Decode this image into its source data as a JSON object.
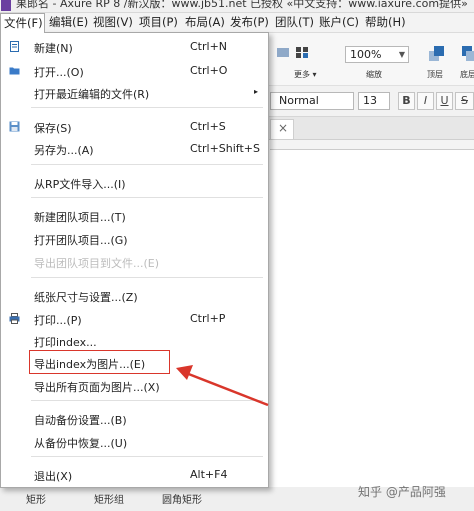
{
  "window": {
    "title": "果郎名 - Axure RP 8 /新汉版：www.jb51.net  已授权      «中文支持：www.iaxure.com提供»"
  },
  "menubar": {
    "items": [
      "文件(F)",
      "编辑(E)",
      "视图(V)",
      "项目(P)",
      "布局(A)",
      "发布(P)",
      "团队(T)",
      "账户(C)",
      "帮助(H)"
    ]
  },
  "toolbar": {
    "zoom_value": "100%",
    "zoom_label": "缩放",
    "more_label": "更多 ▾",
    "top_label": "顶层",
    "bottom_label": "底层"
  },
  "formatbar": {
    "font_value": "Normal",
    "size_value": "13",
    "bold": "B",
    "italic": "I",
    "underline": "U",
    "strike": "S"
  },
  "tabstrip": {
    "close": "×"
  },
  "file_menu": {
    "items": [
      {
        "label": "新建(N)",
        "shortcut": "Ctrl+N"
      },
      {
        "label": "打开...(O)",
        "shortcut": "Ctrl+O"
      },
      {
        "label": "打开最近编辑的文件(R)",
        "submenu": "▸"
      },
      {
        "label": "保存(S)",
        "shortcut": "Ctrl+S"
      },
      {
        "label": "另存为...(A)",
        "shortcut": "Ctrl+Shift+S"
      },
      {
        "label": "从RP文件导入...(I)"
      },
      {
        "label": "新建团队项目...(T)"
      },
      {
        "label": "打开团队项目...(G)"
      },
      {
        "label": "导出团队项目到文件...(E)"
      },
      {
        "label": "纸张尺寸与设置...(Z)"
      },
      {
        "label": "打印...(P)",
        "shortcut": "Ctrl+P"
      },
      {
        "label": "打印index..."
      },
      {
        "label": "导出index为图片...(E)"
      },
      {
        "label": "导出所有页面为图片...(X)"
      },
      {
        "label": "自动备份设置...(B)"
      },
      {
        "label": "从备份中恢复...(U)"
      },
      {
        "label": "退出(X)",
        "shortcut": "Alt+F4"
      }
    ]
  },
  "bottom_widgets": [
    "矩形",
    "矩形组",
    "圆角矩形"
  ],
  "watermark": "知乎 @产品阿强",
  "colors": {
    "highlight": "#d9362b",
    "accent": "#2b6cb0",
    "disabled_text": "#bcbcbc"
  }
}
